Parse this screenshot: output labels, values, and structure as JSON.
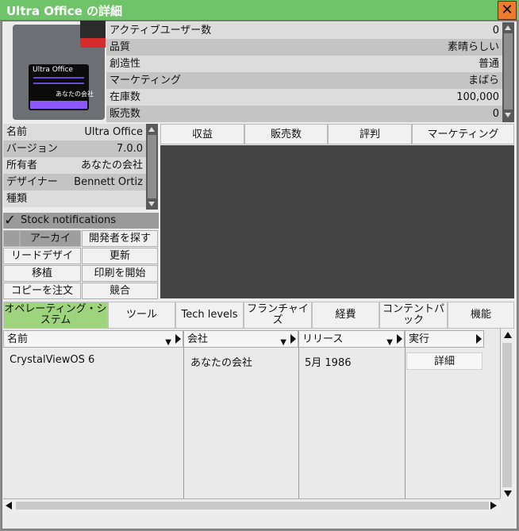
{
  "window": {
    "title": "Ultra Office の詳細",
    "close_label": "✕"
  },
  "icon": {
    "product_name": "Ultra Office",
    "owner": "あなたの会社"
  },
  "stats": [
    {
      "label": "アクティブユーザー数",
      "value": "0"
    },
    {
      "label": "品質",
      "value": "素晴らしい"
    },
    {
      "label": "創造性",
      "value": "普通"
    },
    {
      "label": "マーケティング",
      "value": "まばら"
    },
    {
      "label": "在庫数",
      "value": "100,000"
    },
    {
      "label": "販売数",
      "value": "0"
    }
  ],
  "info": [
    {
      "label": "名前",
      "value": "Ultra Office"
    },
    {
      "label": "バージョン",
      "value": "7.0.0"
    },
    {
      "label": "所有者",
      "value": "あなたの会社"
    },
    {
      "label": "デザイナー",
      "value": "Bennett Ortiz"
    },
    {
      "label": "種類",
      "value": ""
    }
  ],
  "stock_notifications": {
    "label": "Stock notifications",
    "checked": true
  },
  "buttons": {
    "archive": "アーカイ",
    "find_dev": "開発者を探す",
    "lead_design": "リードデザイ",
    "update": "更新",
    "transfer": "移植",
    "start_print": "印刷を開始",
    "order_copies": "コピーを注文",
    "compete": "競合"
  },
  "chart_tabs": [
    "収益",
    "販売数",
    "評判",
    "マーケティング"
  ],
  "main_tabs": [
    "オペレーティング・システム",
    "ツール",
    "Tech levels",
    "フランチャイズ",
    "経費",
    "コンテントパック",
    "機能"
  ],
  "table": {
    "headers": [
      "名前",
      "会社",
      "リリース",
      "実行"
    ],
    "rows": [
      {
        "name": "CrystalViewOS 6",
        "company": "あなたの会社",
        "release": "5月 1986",
        "action": "詳細"
      }
    ]
  },
  "colors": {
    "title_bar": "#6fc46a",
    "active_tab": "#9fd47f",
    "close": "#ec7b2c",
    "chart_bg": "#444444"
  }
}
